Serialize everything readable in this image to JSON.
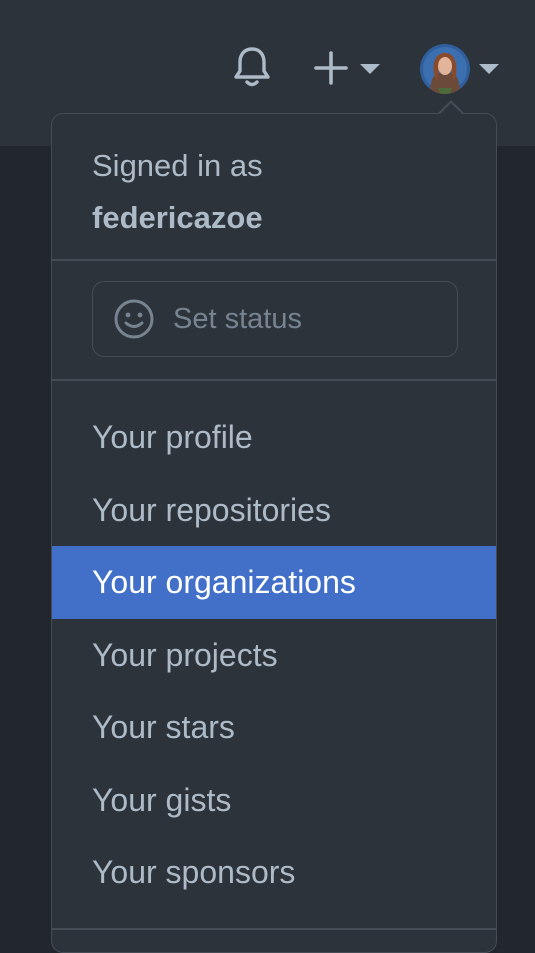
{
  "header": {
    "notifications_icon": "bell-icon",
    "create_icon": "plus-icon",
    "avatar_icon": "avatar"
  },
  "dropdown": {
    "signed_in_label": "Signed in as",
    "username": "federicazoe",
    "status_label": "Set status",
    "items": [
      {
        "label": "Your profile",
        "active": false
      },
      {
        "label": "Your repositories",
        "active": false
      },
      {
        "label": "Your organizations",
        "active": true
      },
      {
        "label": "Your projects",
        "active": false
      },
      {
        "label": "Your stars",
        "active": false
      },
      {
        "label": "Your gists",
        "active": false
      },
      {
        "label": "Your sponsors",
        "active": false
      }
    ]
  },
  "colors": {
    "page_bg": "#22272e",
    "header_bg": "#2d333b",
    "border": "#444c56",
    "text": "#adbac7",
    "muted_text": "#768390",
    "highlight": "#4270c9"
  }
}
